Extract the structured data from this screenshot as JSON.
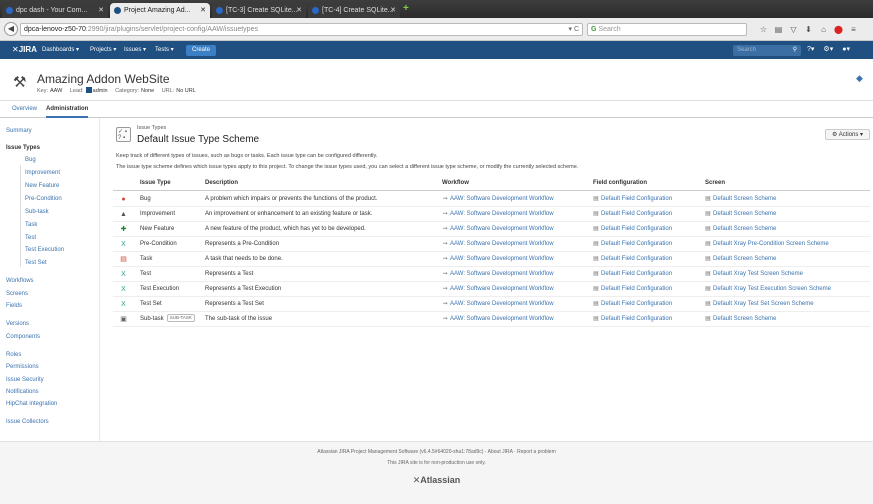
{
  "browser": {
    "tabs": [
      {
        "label": "dpc dash - Your Com...",
        "active": false
      },
      {
        "label": "Project Amazing Ad...",
        "active": true
      },
      {
        "label": "[TC-3] Create SQLite...",
        "active": false
      },
      {
        "label": "[TC-4] Create SQLite...",
        "active": false
      }
    ],
    "url_host": "dpca-lenovo-z50-70",
    "url_rest": ":2990/jira/plugins/servlet/project-config/AAW/issuetypes",
    "search_placeholder": "Search"
  },
  "jira": {
    "logo": "JIRA",
    "menu": [
      "Dashboards ▾",
      "Projects ▾",
      "Issues ▾",
      "Tests ▾"
    ],
    "create_label": "Create",
    "search_placeholder": "Search"
  },
  "project": {
    "name": "Amazing Addon WebSite",
    "key_label": "Key:",
    "key": "AAW",
    "lead_label": "Lead:",
    "lead": "admin",
    "category_label": "Category:",
    "category": "None",
    "url_label": "URL:",
    "url": "No URL",
    "tabs": [
      "Overview",
      "Administration"
    ]
  },
  "sidebar": {
    "summary": "Summary",
    "issue_types": "Issue Types",
    "issue_type_items": [
      "Bug",
      "Improvement",
      "New Feature",
      "Pre-Condition",
      "Sub-task",
      "Task",
      "Test",
      "Test Execution",
      "Test Set"
    ],
    "group2": [
      "Workflows",
      "Screens",
      "Fields"
    ],
    "group3": [
      "Versions",
      "Components"
    ],
    "group4": [
      "Roles",
      "Permissions",
      "Issue Security",
      "Notifications",
      "HipChat integration"
    ],
    "group5": [
      "Issue Collectors"
    ]
  },
  "scheme": {
    "crumb": "Issue Types",
    "title": "Default Issue Type Scheme",
    "actions_label": "Actions ▾",
    "desc1": "Keep track of different types of issues, such as bugs or tasks. Each issue type can be configured differently.",
    "desc2": "The issue type scheme defines which issue types apply to this project. To change the issue types used, you can select a different issue type scheme, or modify the currently selected scheme."
  },
  "table": {
    "headers": [
      "Issue Type",
      "Description",
      "Workflow",
      "Field configuration",
      "Screen"
    ],
    "rows": [
      {
        "type": "Bug",
        "desc": "A problem which impairs or prevents the functions of the product.",
        "workflow": "AAW: Software Development Workflow",
        "field": "Default Field Configuration",
        "screen": "Default Screen Scheme",
        "icon": "bug-icon",
        "color": "#d04437",
        "glyph": "●"
      },
      {
        "type": "Improvement",
        "desc": "An improvement or enhancement to an existing feature or task.",
        "workflow": "AAW: Software Development Workflow",
        "field": "Default Field Configuration",
        "screen": "Default Screen Scheme",
        "icon": "improvement-icon",
        "color": "#555555",
        "glyph": "▲"
      },
      {
        "type": "New Feature",
        "desc": "A new feature of the product, which has yet to be developed.",
        "workflow": "AAW: Software Development Workflow",
        "field": "Default Field Configuration",
        "screen": "Default Screen Scheme",
        "icon": "new-feature-icon",
        "color": "#14892c",
        "glyph": "✚"
      },
      {
        "type": "Pre-Condition",
        "desc": "Represents a Pre-Condition",
        "workflow": "AAW: Software Development Workflow",
        "field": "Default Field Configuration",
        "screen": "Default Xray Pre-Condition Screen Scheme",
        "icon": "xray-precondition-icon",
        "color": "#2a9d8f",
        "glyph": "X"
      },
      {
        "type": "Task",
        "desc": "A task that needs to be done.",
        "workflow": "AAW: Software Development Workflow",
        "field": "Default Field Configuration",
        "screen": "Default Screen Scheme",
        "icon": "task-icon",
        "color": "#d04437",
        "glyph": "▤"
      },
      {
        "type": "Test",
        "desc": "Represents a Test",
        "workflow": "AAW: Software Development Workflow",
        "field": "Default Field Configuration",
        "screen": "Default Xray Test Screen Scheme",
        "icon": "xray-test-icon",
        "color": "#2a9d8f",
        "glyph": "X"
      },
      {
        "type": "Test Execution",
        "desc": "Represents a Test Execution",
        "workflow": "AAW: Software Development Workflow",
        "field": "Default Field Configuration",
        "screen": "Default Xray Test Execution Screen Scheme",
        "icon": "xray-test-execution-icon",
        "color": "#2a9d8f",
        "glyph": "X"
      },
      {
        "type": "Test Set",
        "desc": "Represents a Test Set",
        "workflow": "AAW: Software Development Workflow",
        "field": "Default Field Configuration",
        "screen": "Default Xray Test Set Screen Scheme",
        "icon": "xray-test-set-icon",
        "color": "#2a9d8f",
        "glyph": "X"
      },
      {
        "type": "Sub-task",
        "desc": "The sub-task of the issue",
        "workflow": "AAW: Software Development Workflow",
        "field": "Default Field Configuration",
        "screen": "Default Screen Scheme",
        "icon": "subtask-icon",
        "color": "#666666",
        "glyph": "▣",
        "tag": "SUB-TASK"
      }
    ]
  },
  "footer": {
    "line1": "Atlassian JIRA Project Management Software (v6.4.5#64020-sha1:78ad9c)",
    "about": "About JIRA",
    "report": "Report a problem",
    "line2": "This JIRA site is for non-production use only.",
    "logo": "Atlassian"
  }
}
